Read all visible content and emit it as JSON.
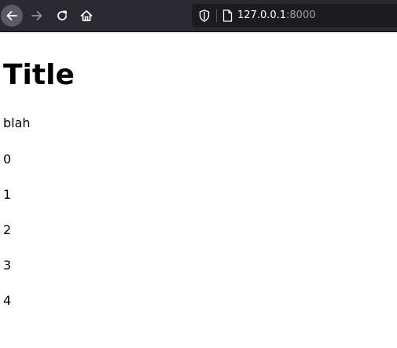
{
  "browser": {
    "url_host": "127.0.0.1",
    "url_port": ":8000",
    "icons": [
      "back-icon",
      "forward-icon",
      "reload-icon",
      "home-icon",
      "shield-icon",
      "page-icon"
    ],
    "colors": {
      "toolbar_bg": "#2b2a33",
      "urlbar_bg": "#1c1b22",
      "back_button_hover": "#5b5b66"
    }
  },
  "page": {
    "title": "Title",
    "paragraphs": [
      "blah",
      "0",
      "1",
      "2",
      "3",
      "4"
    ]
  }
}
